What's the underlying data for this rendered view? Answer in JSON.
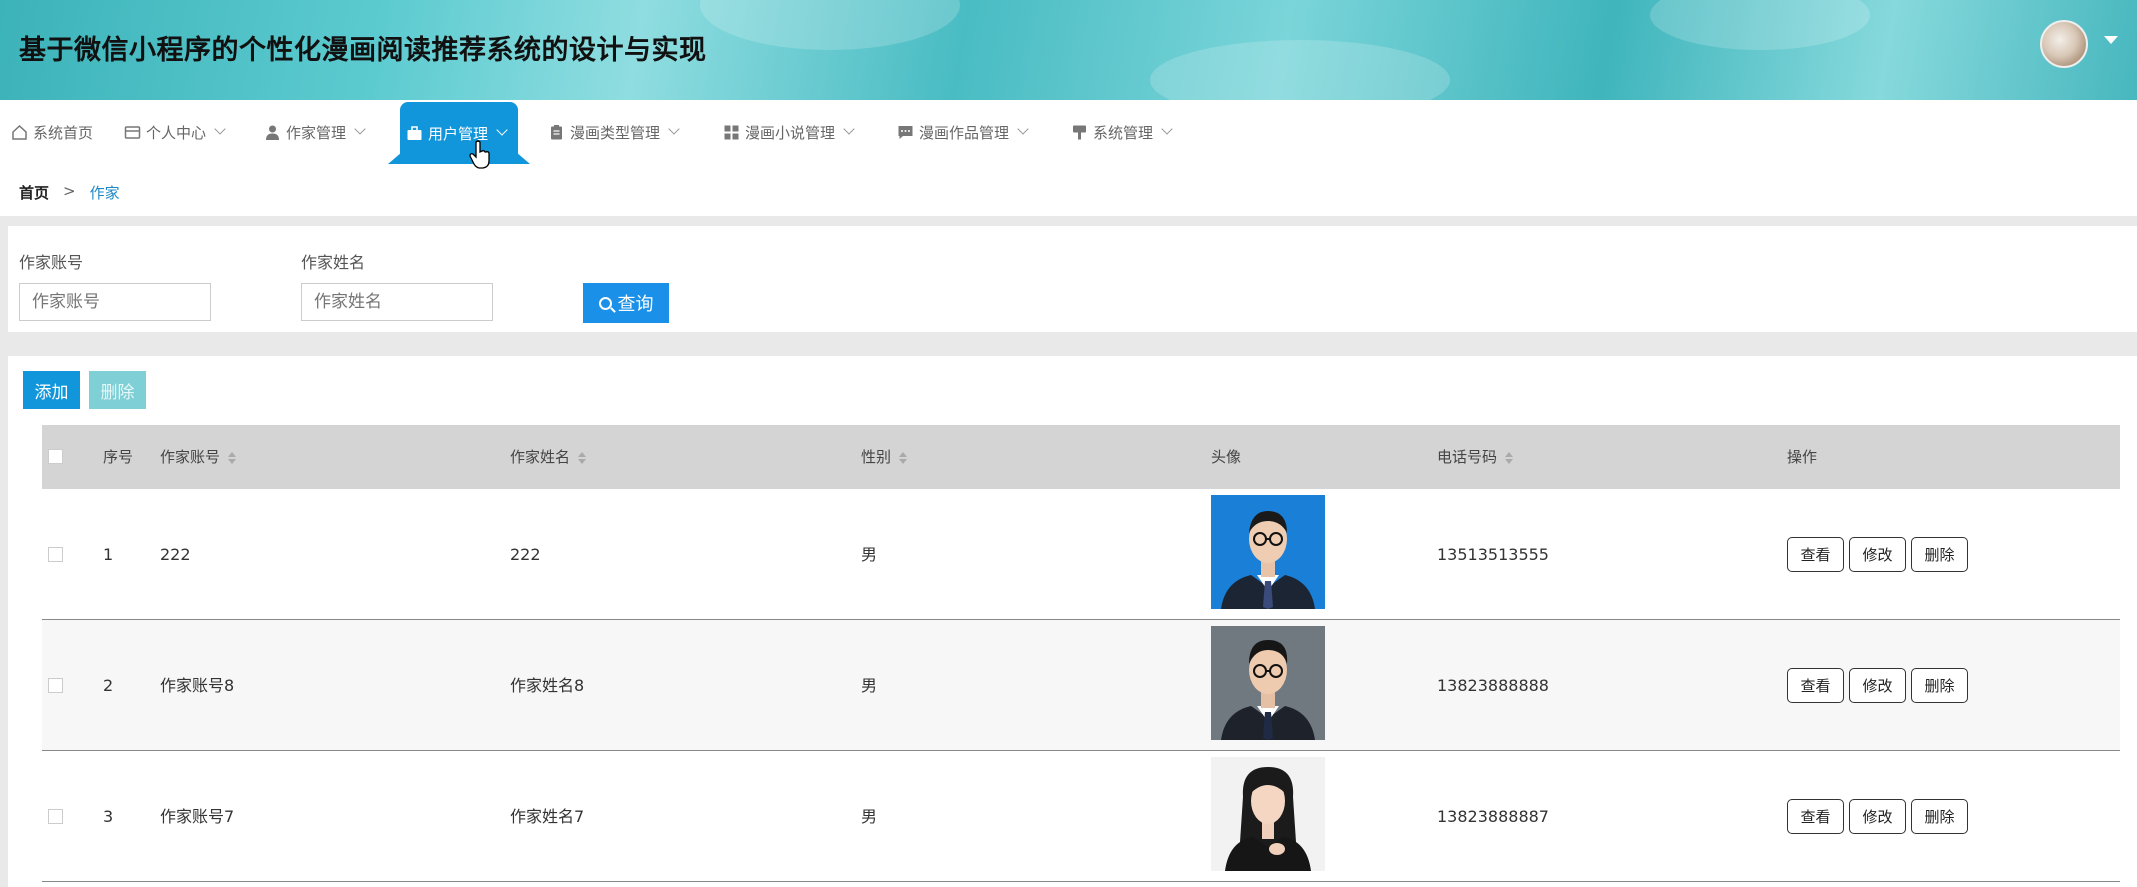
{
  "header": {
    "title": "基于微信小程序的个性化漫画阅读推荐系统的设计与实现"
  },
  "nav": {
    "items": [
      {
        "label": "系统首页",
        "icon": "home-icon"
      },
      {
        "label": "个人中心",
        "icon": "id-card-icon"
      },
      {
        "label": "作家管理",
        "icon": "person-icon"
      },
      {
        "label": "用户管理",
        "icon": "briefcase-icon",
        "active": true
      },
      {
        "label": "漫画类型管理",
        "icon": "clipboard-icon"
      },
      {
        "label": "漫画小说管理",
        "icon": "grid-icon"
      },
      {
        "label": "漫画作品管理",
        "icon": "chat-icon"
      },
      {
        "label": "系统管理",
        "icon": "paintbrush-icon"
      }
    ]
  },
  "breadcrumb": {
    "home": "首页",
    "separator": ">",
    "current": "作家"
  },
  "search": {
    "account_label": "作家账号",
    "account_placeholder": "作家账号",
    "name_label": "作家姓名",
    "name_placeholder": "作家姓名",
    "query_label": "查询"
  },
  "toolbar": {
    "add_label": "添加",
    "delete_label": "删除"
  },
  "table": {
    "headers": {
      "index": "序号",
      "account": "作家账号",
      "name": "作家姓名",
      "gender": "性别",
      "avatar": "头像",
      "phone": "电话号码",
      "actions": "操作"
    },
    "rows": [
      {
        "index": "1",
        "account": "222",
        "name": "222",
        "gender": "男",
        "phone": "13513513555",
        "photo_bg": "#1a7fd6"
      },
      {
        "index": "2",
        "account": "作家账号8",
        "name": "作家姓名8",
        "gender": "男",
        "phone": "13823888888",
        "photo_bg": "#707880"
      },
      {
        "index": "3",
        "account": "作家账号7",
        "name": "作家姓名7",
        "gender": "男",
        "phone": "13823888887",
        "photo_bg": "#f2f2f2"
      }
    ],
    "action_labels": {
      "view": "查看",
      "edit": "修改",
      "delete": "删除"
    }
  },
  "colors": {
    "accent": "#1296db",
    "query_button": "#1a90e8",
    "disabled_delete": "#7fcfd6",
    "header_teal": "#49bcc3"
  }
}
